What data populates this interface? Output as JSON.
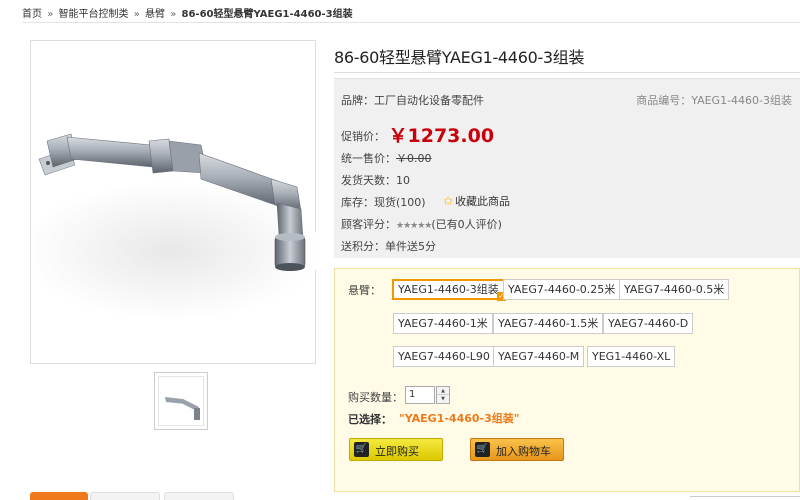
{
  "breadcrumb": {
    "items": [
      "首页",
      "智能平台控制类",
      "悬臂"
    ],
    "separator": "»",
    "current": "86-60轻型悬臂YAEG1-4460-3组装"
  },
  "product": {
    "title": "86-60轻型悬臂YAEG1-4460-3组装",
    "brand": "品牌：工厂自动化设备零配件",
    "code": "商品编号：YAEG1-4460-3组装",
    "promo_label": "促销价：",
    "promo_price": "￥1273.00",
    "retail_label": "统一售价：",
    "retail_price": "￥0.00",
    "ship_days": "发货天数：10",
    "stock": "库存：现货(100)",
    "favorite": "收藏此商品",
    "rating_label": "顾客评分：",
    "rating_stars": "★★★★★",
    "rating_text": "(已有0人评价)",
    "points": "送积分：单件送5分"
  },
  "options": {
    "label": "悬臂：",
    "items": [
      "YAEG1-4460-3组装",
      "YAEG7-4460-0.25米",
      "YAEG7-4460-0.5米",
      "YAEG7-4460-1米",
      "YAEG7-4460-1.5米",
      "YAEG7-4460-D",
      "YAEG7-4460-L90",
      "YAEG7-4460-M",
      "YEG1-4460-XL"
    ],
    "selected_index": 0,
    "check_icon": "✓"
  },
  "quantity": {
    "label": "购买数量：",
    "value": "1",
    "up_icon": "▲",
    "down_icon": "▼"
  },
  "chosen": {
    "label": "已选择：",
    "value": "\"YAEG1-4460-3组装\""
  },
  "buttons": {
    "buy_now": "立即购买",
    "add_cart": "加入购物车",
    "cart_icon": "🛒"
  },
  "colors": {
    "price": "#c7000b",
    "accent": "#f07a1b",
    "selected_border": "#f39800"
  }
}
